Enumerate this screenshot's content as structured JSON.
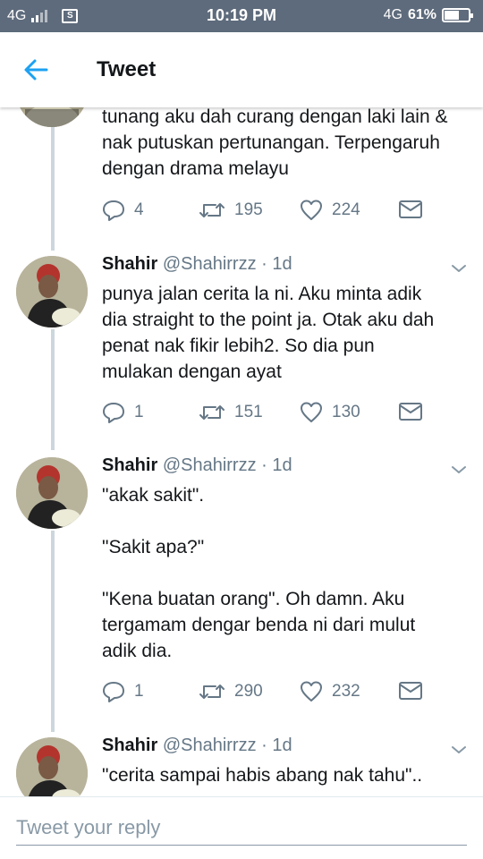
{
  "status_bar": {
    "network": "4G",
    "network_right": "4G",
    "time": "10:19 PM",
    "battery_percent": "61%",
    "battery_level": 0.61,
    "sim_label": "S"
  },
  "header": {
    "title": "Tweet"
  },
  "tweets": [
    {
      "lines": [
        "tunang aku dah curang dengan laki lain &",
        "nak putuskan pertunangan. Terpengaruh",
        "dengan drama melayu"
      ],
      "replies": "4",
      "retweets": "195",
      "likes": "224"
    },
    {
      "name": "Shahir",
      "handle": "@Shahirrzz",
      "separator": "·",
      "time": "1d",
      "lines": [
        "punya jalan cerita la ni. Aku minta adik",
        "dia straight to the point ja. Otak aku dah",
        "penat nak fikir lebih2. So dia pun",
        "mulakan dengan ayat"
      ],
      "replies": "1",
      "retweets": "151",
      "likes": "130"
    },
    {
      "name": "Shahir",
      "handle": "@Shahirrzz",
      "separator": "·",
      "time": "1d",
      "lines": [
        "\"akak sakit\".",
        "",
        "\"Sakit apa?\"",
        "",
        "\"Kena buatan orang\". Oh damn. Aku",
        "tergamam dengar benda ni dari mulut",
        "adik dia."
      ],
      "replies": "1",
      "retweets": "290",
      "likes": "232"
    },
    {
      "name": "Shahir",
      "handle": "@Shahirrzz",
      "separator": "·",
      "time": "1d",
      "lines": [
        "\"cerita sampai habis abang nak tahu\".."
      ]
    }
  ],
  "reply_bar": {
    "placeholder": "Tweet your reply"
  },
  "colors": {
    "status_bar": "#5e6b7c",
    "accent": "#1da1f2",
    "secondary_text": "#657786",
    "thread_line": "#ccd6dd"
  },
  "icons": [
    "back-arrow-icon",
    "chevron-down-icon",
    "reply-icon",
    "retweet-icon",
    "heart-icon",
    "direct-message-icon",
    "battery-icon",
    "signal-icon",
    "sim-icon"
  ]
}
